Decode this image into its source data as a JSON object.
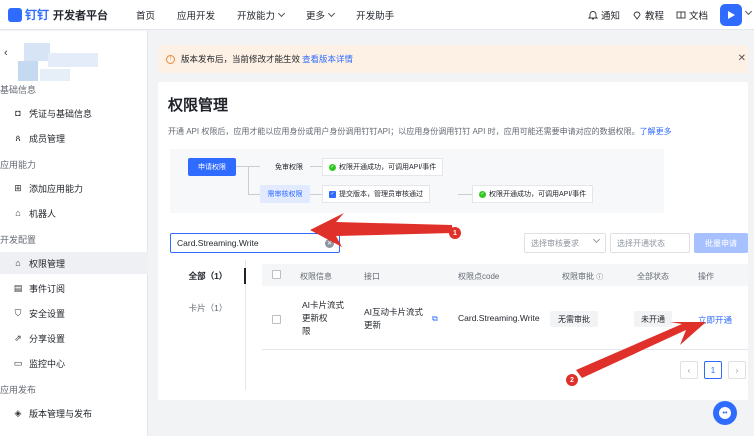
{
  "header": {
    "logo_brand": "钉钉",
    "logo_title": "开发者平台",
    "nav": [
      "首页",
      "应用开发",
      "开放能力",
      "更多",
      "开发助手"
    ],
    "notify": "通知",
    "tutorial": "教程",
    "docs": "文档"
  },
  "sidebar": {
    "groups": [
      "基础信息",
      "应用能力",
      "开发配置",
      "应用发布"
    ],
    "items": [
      "凭证与基础信息",
      "成员管理",
      "添加应用能力",
      "机器人",
      "权限管理",
      "事件订阅",
      "安全设置",
      "分享设置",
      "监控中心",
      "版本管理与发布"
    ]
  },
  "banner": {
    "text": "版本发布后，当前修改才能生效",
    "link": "查看版本详情"
  },
  "page": {
    "title": "权限管理",
    "desc": "开通 API 权限后，应用才能以应用身份或用户身份调用钉钉API；以应用身份调用钉钉 API 时，应用可能还需要申请对应的数据权限。",
    "desc_link": "了解更多"
  },
  "flow": {
    "apply": "申请权限",
    "free": "免审权限",
    "free_result": "权限开通成功，可调用API/事件",
    "review": "需审核权限",
    "review_step": "提交版本，管理员审核通过",
    "review_result": "权限开通成功，可调用API/事件"
  },
  "filters": {
    "search_value": "Card.Streaming.Write",
    "review_placeholder": "选择审核要求",
    "status_placeholder": "选择开通状态",
    "batch_label": "批量申请"
  },
  "tabs": [
    {
      "label": "全部（1）"
    },
    {
      "label": "卡片（1）"
    }
  ],
  "table": {
    "headers": [
      "权限信息",
      "接口",
      "权限点code",
      "权限审批",
      "全部状态",
      "操作"
    ],
    "rows": [
      {
        "info": [
          "AI卡片流式",
          "更新权",
          "限"
        ],
        "api": [
          "AI互动卡片流式",
          "更新"
        ],
        "code": "Card.Streaming.Write",
        "approval": "无需审批",
        "status": "未开通",
        "action": "立即开通"
      }
    ]
  },
  "pagination": {
    "current": "1"
  },
  "annotations": [
    "1",
    "2"
  ],
  "colors": {
    "accent": "#2f6bff",
    "arrow": "#e0302a",
    "banner_bg": "#fdf0e4"
  }
}
